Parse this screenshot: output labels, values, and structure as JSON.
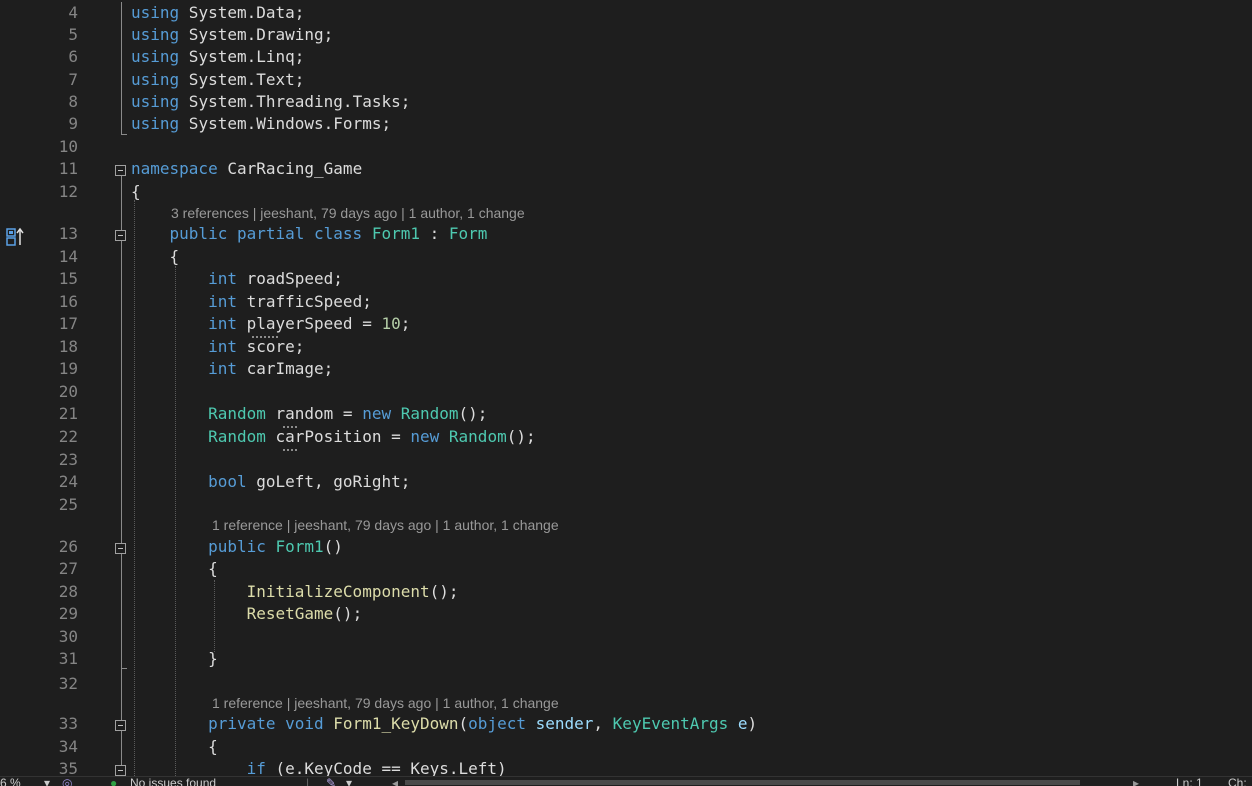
{
  "editor": {
    "lines": [
      {
        "num": "4",
        "tokens": [
          [
            "kw",
            "using"
          ],
          [
            "pl",
            " System"
          ],
          [
            "pl",
            "."
          ],
          [
            "pl",
            "Data;"
          ]
        ]
      },
      {
        "num": "5",
        "tokens": [
          [
            "kw",
            "using"
          ],
          [
            "pl",
            " System.Drawing;"
          ]
        ]
      },
      {
        "num": "6",
        "tokens": [
          [
            "kw",
            "using"
          ],
          [
            "pl",
            " System.Linq;"
          ]
        ]
      },
      {
        "num": "7",
        "tokens": [
          [
            "kw",
            "using"
          ],
          [
            "pl",
            " System.Text;"
          ]
        ]
      },
      {
        "num": "8",
        "tokens": [
          [
            "kw",
            "using"
          ],
          [
            "pl",
            " System.Threading.Tasks;"
          ]
        ]
      },
      {
        "num": "9",
        "tokens": [
          [
            "kw",
            "using"
          ],
          [
            "pl",
            " System.Windows.Forms;"
          ]
        ]
      },
      {
        "num": "10",
        "tokens": []
      },
      {
        "num": "11",
        "tokens": [
          [
            "kw",
            "namespace"
          ],
          [
            "pl",
            " CarRacing_Game"
          ]
        ]
      },
      {
        "num": "12",
        "tokens": [
          [
            "pl",
            "{"
          ]
        ]
      },
      {
        "num": "13",
        "tokens": [
          [
            "pl",
            "    "
          ],
          [
            "kw",
            "public partial class "
          ],
          [
            "ty",
            "Form1"
          ],
          [
            "pl",
            " : "
          ],
          [
            "ty",
            "Form"
          ]
        ]
      },
      {
        "num": "14",
        "tokens": [
          [
            "pl",
            "    {"
          ]
        ]
      },
      {
        "num": "15",
        "tokens": [
          [
            "pl",
            "        "
          ],
          [
            "kw",
            "int"
          ],
          [
            "pl",
            " roadSpeed;"
          ]
        ]
      },
      {
        "num": "16",
        "tokens": [
          [
            "pl",
            "        "
          ],
          [
            "kw",
            "int"
          ],
          [
            "pl",
            " trafficSpeed;"
          ]
        ]
      },
      {
        "num": "17",
        "tokens": [
          [
            "pl",
            "        "
          ],
          [
            "kw",
            "int"
          ],
          [
            "pl",
            " playerSpeed = "
          ],
          [
            "num",
            "10"
          ],
          [
            "pl",
            ";"
          ]
        ]
      },
      {
        "num": "18",
        "tokens": [
          [
            "pl",
            "        "
          ],
          [
            "kw",
            "int"
          ],
          [
            "pl",
            " score;"
          ]
        ]
      },
      {
        "num": "19",
        "tokens": [
          [
            "pl",
            "        "
          ],
          [
            "kw",
            "int"
          ],
          [
            "pl",
            " carImage;"
          ]
        ]
      },
      {
        "num": "20",
        "tokens": []
      },
      {
        "num": "21",
        "tokens": [
          [
            "pl",
            "        "
          ],
          [
            "ty",
            "Random"
          ],
          [
            "pl",
            " random = "
          ],
          [
            "kw",
            "new"
          ],
          [
            "pl",
            " "
          ],
          [
            "ty",
            "Random"
          ],
          [
            "pl",
            "();"
          ]
        ]
      },
      {
        "num": "22",
        "tokens": [
          [
            "pl",
            "        "
          ],
          [
            "ty",
            "Random"
          ],
          [
            "pl",
            " carPosition = "
          ],
          [
            "kw",
            "new"
          ],
          [
            "pl",
            " "
          ],
          [
            "ty",
            "Random"
          ],
          [
            "pl",
            "();"
          ]
        ]
      },
      {
        "num": "23",
        "tokens": []
      },
      {
        "num": "24",
        "tokens": [
          [
            "pl",
            "        "
          ],
          [
            "kw",
            "bool"
          ],
          [
            "pl",
            " goLeft, goRight;"
          ]
        ]
      },
      {
        "num": "25",
        "tokens": []
      },
      {
        "num": "26",
        "tokens": [
          [
            "pl",
            "        "
          ],
          [
            "kw",
            "public"
          ],
          [
            "pl",
            " "
          ],
          [
            "ty",
            "Form1"
          ],
          [
            "pl",
            "()"
          ]
        ]
      },
      {
        "num": "27",
        "tokens": [
          [
            "pl",
            "        {"
          ]
        ]
      },
      {
        "num": "28",
        "tokens": [
          [
            "pl",
            "            "
          ],
          [
            "fn",
            "InitializeComponent"
          ],
          [
            "pl",
            "();"
          ]
        ]
      },
      {
        "num": "29",
        "tokens": [
          [
            "pl",
            "            "
          ],
          [
            "fn",
            "ResetGame"
          ],
          [
            "pl",
            "();"
          ]
        ]
      },
      {
        "num": "30",
        "tokens": []
      },
      {
        "num": "31",
        "tokens": [
          [
            "pl",
            "        }"
          ]
        ]
      },
      {
        "num": "32",
        "tokens": []
      },
      {
        "num": "33",
        "tokens": [
          [
            "pl",
            "        "
          ],
          [
            "kw",
            "private void"
          ],
          [
            "pl",
            " "
          ],
          [
            "fn",
            "Form1_KeyDown"
          ],
          [
            "pl",
            "("
          ],
          [
            "kw",
            "object"
          ],
          [
            "pl",
            " "
          ],
          [
            "id",
            "sender"
          ],
          [
            "pl",
            ", "
          ],
          [
            "ty",
            "KeyEventArgs"
          ],
          [
            "pl",
            " "
          ],
          [
            "id",
            "e"
          ],
          [
            "pl",
            ")"
          ]
        ]
      },
      {
        "num": "34",
        "tokens": [
          [
            "pl",
            "        {"
          ]
        ]
      },
      {
        "num": "35",
        "tokens": [
          [
            "pl",
            "            "
          ],
          [
            "kw",
            "if"
          ],
          [
            "pl",
            " (e.KeyCode == Keys.Left)"
          ]
        ]
      }
    ],
    "codelens": [
      "3 references | jeeshant, 79 days ago | 1 author, 1 change",
      "1 reference | jeeshant, 79 days ago | 1 author, 1 change",
      "1 reference | jeeshant, 79 days ago | 1 author, 1 change"
    ]
  },
  "statusbar": {
    "zoom": "6 %",
    "issues": "No issues found",
    "position": "Ln: 1",
    "encoding": "Ch:"
  },
  "colors": {
    "background": "#1e1e1e",
    "keyword": "#569cd6",
    "type": "#4ec9b0",
    "method": "#dcdcaa",
    "parameter": "#9cdcfe",
    "number": "#b5cea8",
    "text": "#dcdcdc",
    "line_number": "#858585",
    "codelens": "#999999"
  }
}
